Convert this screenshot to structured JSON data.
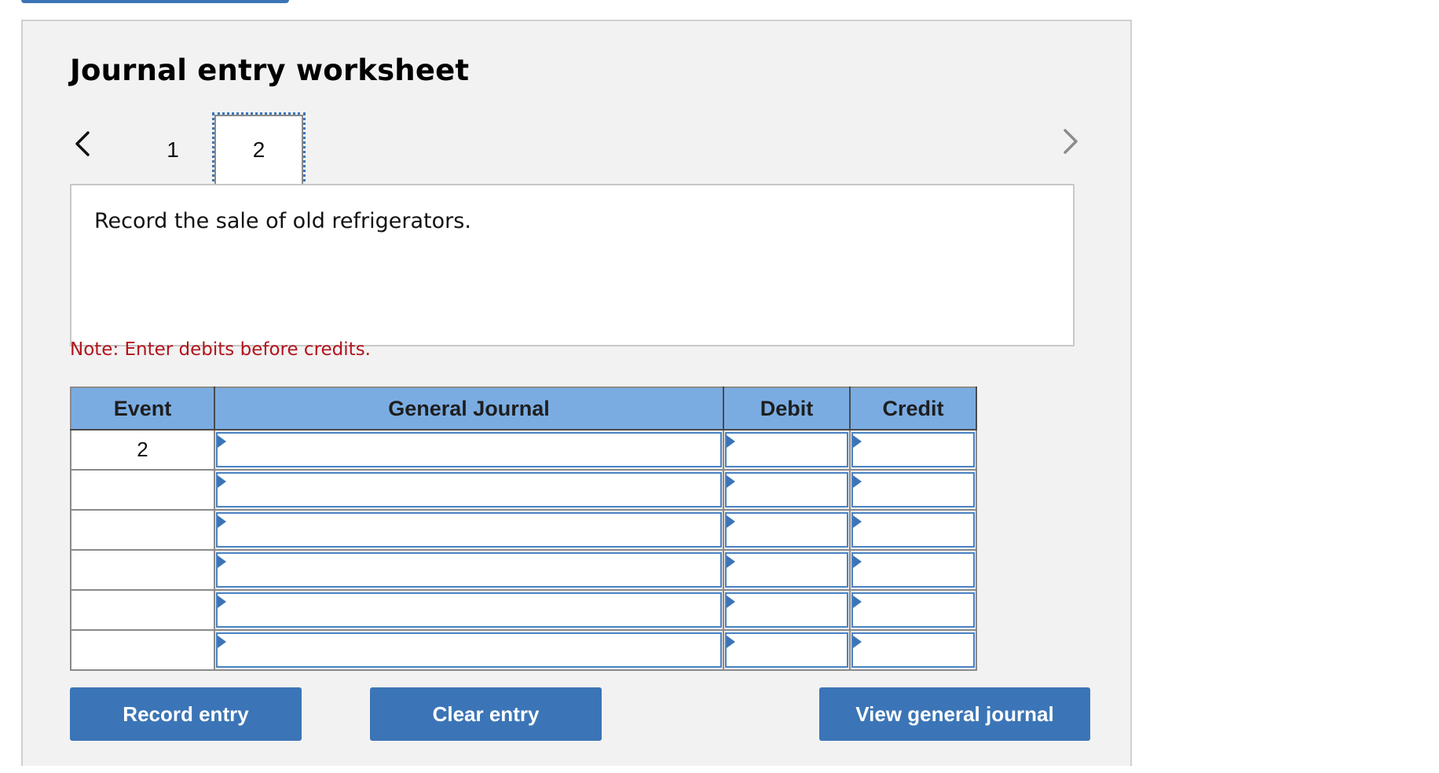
{
  "title": "Journal entry worksheet",
  "navigation": {
    "prev_icon": "chevron-left-icon",
    "next_icon": "chevron-right-icon",
    "tabs": [
      {
        "label": "1",
        "active": false
      },
      {
        "label": "2",
        "active": true
      }
    ]
  },
  "prompt": "Record the sale of old refrigerators.",
  "note": "Note: Enter debits before credits.",
  "table": {
    "headers": [
      "Event",
      "General Journal",
      "Debit",
      "Credit"
    ],
    "rows": [
      {
        "event": "2",
        "account": "",
        "debit": "",
        "credit": ""
      },
      {
        "event": "",
        "account": "",
        "debit": "",
        "credit": ""
      },
      {
        "event": "",
        "account": "",
        "debit": "",
        "credit": ""
      },
      {
        "event": "",
        "account": "",
        "debit": "",
        "credit": ""
      },
      {
        "event": "",
        "account": "",
        "debit": "",
        "credit": ""
      },
      {
        "event": "",
        "account": "",
        "debit": "",
        "credit": ""
      }
    ]
  },
  "buttons": {
    "record": "Record entry",
    "clear": "Clear entry",
    "view": "View general journal"
  },
  "colors": {
    "accent": "#3b75b7",
    "header_bg": "#7aace2",
    "note": "#b3141c",
    "panel_bg": "#f2f2f2"
  }
}
